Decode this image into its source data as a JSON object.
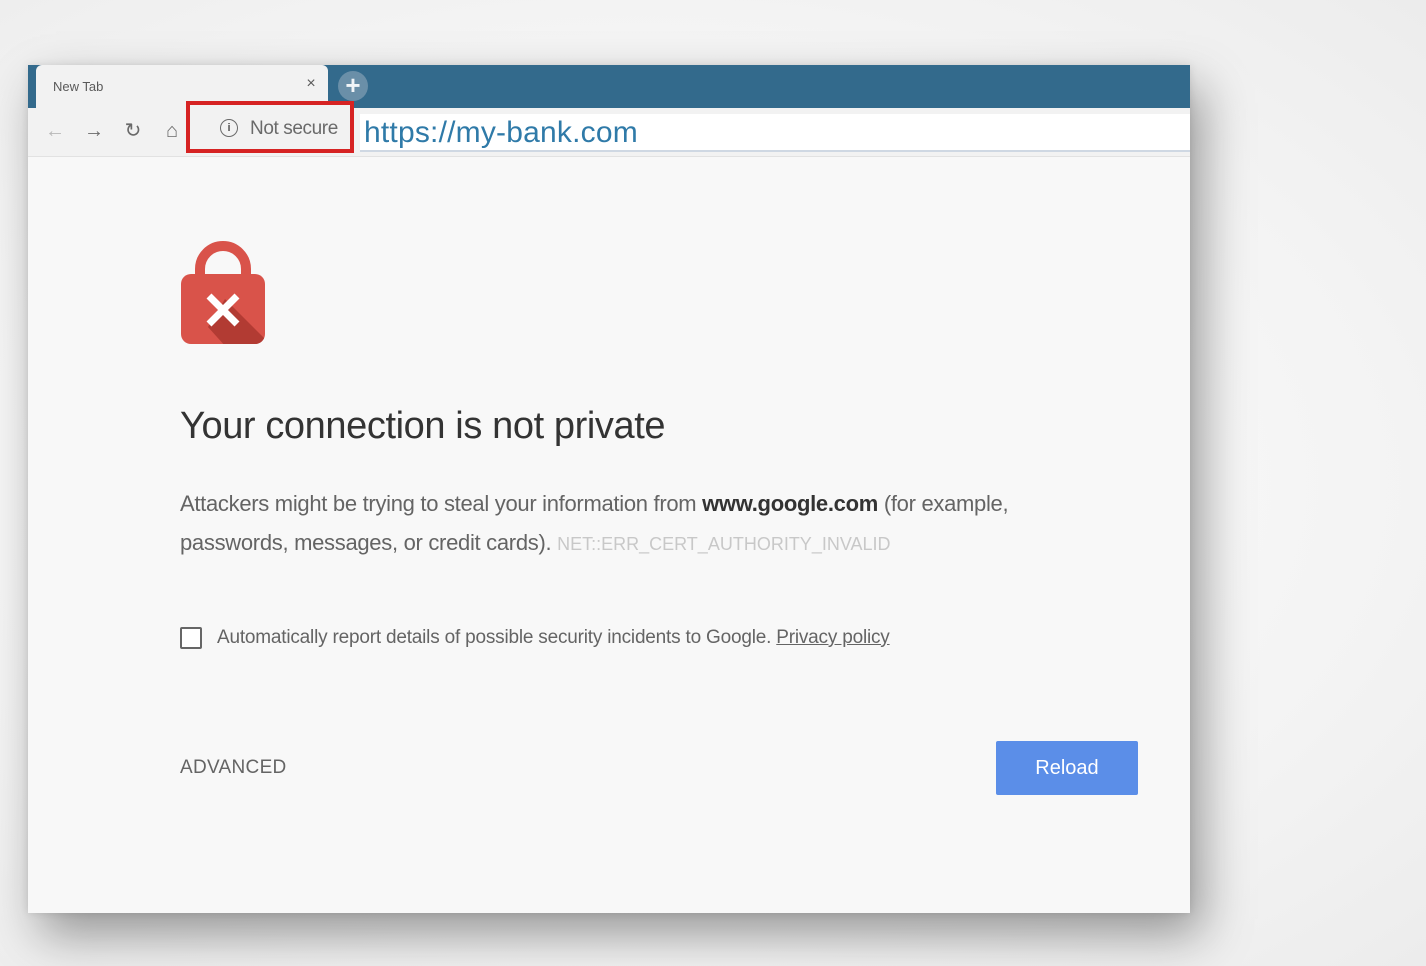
{
  "browser": {
    "tab": {
      "title": "New Tab",
      "close_glyph": "×",
      "new_tab_glyph": "+"
    },
    "nav_glyphs": {
      "back": "←",
      "forward": "→",
      "reload": "↻",
      "home": "⌂"
    },
    "security": {
      "icon_glyph": "i",
      "label": "Not secure",
      "highlight_color": "#d62323"
    },
    "address_bar": {
      "url": "https://my-bank.com"
    },
    "chrome_color": "#336a8c"
  },
  "page": {
    "icon": "broken-lock-icon",
    "heading": "Your connection is not private",
    "message": {
      "before": "Attackers might be trying to steal your information from ",
      "domain": "www.google.com",
      "after": " (for example, passwords, messages, or credit cards).",
      "error_code": "NET::ERR_CERT_AUTHORITY_INVALID"
    },
    "report": {
      "checked": false,
      "label": "Automatically report details of possible security incidents to Google. ",
      "privacy_link": "Privacy policy"
    },
    "advanced_label": "ADVANCED",
    "reload_label": "Reload",
    "accent_color": "#5b8ee8",
    "lock_color": "#d9534a"
  }
}
